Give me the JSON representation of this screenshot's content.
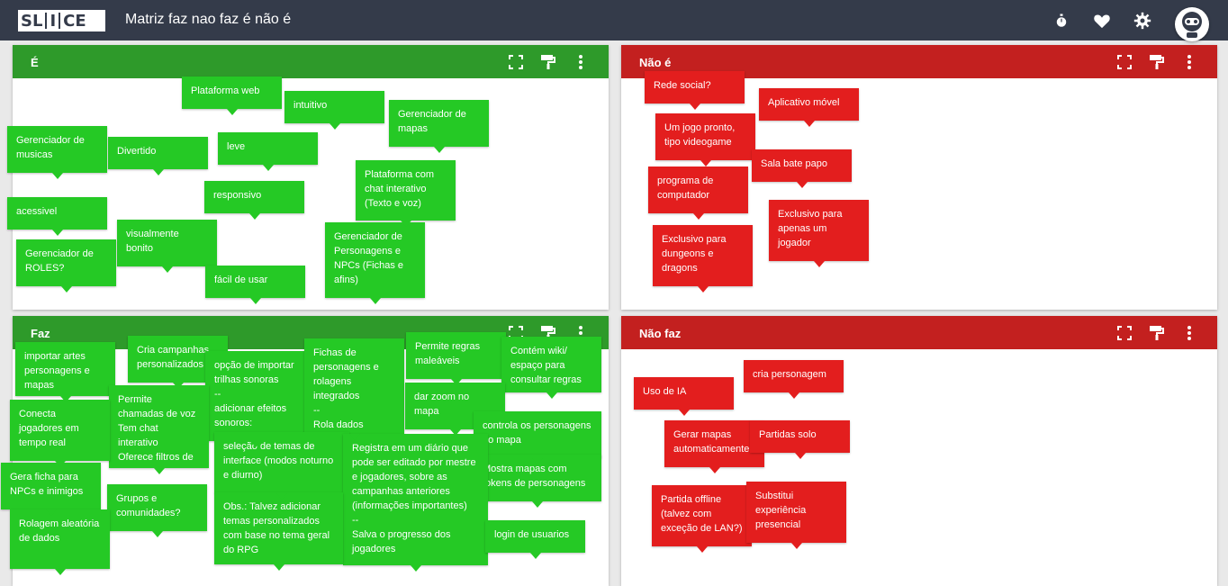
{
  "app": {
    "logo_text": "SLICE",
    "board_title": "Matriz faz nao faz é não é"
  },
  "topbar_icons": [
    "timer-icon",
    "heart-icon",
    "gear-icon",
    "avatar"
  ],
  "colors": {
    "topbar": "#343b4a",
    "green_header": "#2e9a2a",
    "green_note": "#25c925",
    "red_header": "#c3201f",
    "red_note": "#e31e1e"
  },
  "panels": {
    "e": {
      "title": "É",
      "notes": [
        "Plataforma web",
        "intuitivo",
        "Gerenciador de mapas",
        "Gerenciador de musicas",
        "Divertido",
        "leve",
        "responsivo",
        "Plataforma com chat interativo (Texto e voz)",
        "acessivel",
        "visualmente bonito",
        "Gerenciador de ROLES?",
        "fácil de usar",
        "Gerenciador de Personagens e NPCs (Fichas e afins)"
      ]
    },
    "nao_e": {
      "title": "Não é",
      "notes": [
        "Rede social?",
        "Aplicativo móvel",
        "Um jogo pronto, tipo videogame",
        "Sala bate papo",
        "programa de computador",
        "Exclusivo para apenas um jogador",
        "Exclusivo para dungeons e dragons"
      ]
    },
    "faz": {
      "title": "Faz",
      "notes": [
        "importar artes personagens e mapas",
        "Cria campanhas personalizados",
        "opção de importar trilhas sonoras\n--\nadicionar efeitos sonoros:",
        "Fichas de personagens e rolagens integrados\n--\nRola dados automaticamente",
        "Permite regras maleáveis",
        "Contém wiki/ espaço para consultar regras",
        "Permite chamadas de voz\nTem chat interativo\nOferece filtros de voz",
        "Conecta jogadores em tempo real",
        "dar zoom no mapa",
        "controla os personagens no mapa",
        "Mostra mapas com tokens de personagens",
        "seleção de temas de interface (modos noturno e diurno)",
        "Registra em um diário que pode ser editado por mestre e jogadores, sobre as campanhas anteriores (informações importantes)\n--\nSalva o progresso dos jogadores",
        "Gera ficha para NPCs e inimigos",
        "Grupos e comunidades?",
        "Obs.: Talvez adicionar temas personalizados com base no tema geral do RPG",
        "login de usuarios",
        "Rolagem aleatória de dados"
      ]
    },
    "nao_faz": {
      "title": "Não faz",
      "notes": [
        "cria personagem",
        "Uso de IA",
        "Gerar mapas automaticamente",
        "Partidas solo",
        "Partida offline (talvez com exceção de LAN?)",
        "Substitui experiência presencial"
      ]
    }
  }
}
